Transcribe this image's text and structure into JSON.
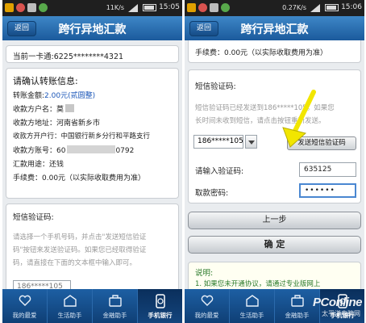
{
  "left": {
    "status": {
      "speed": "11K/s",
      "time": "15:05"
    },
    "header": {
      "back_label": "返回",
      "title": "跨行异地汇款"
    },
    "account_line": "当前一卡通:6225********4321",
    "confirm": {
      "heading": "请确认转账信息:",
      "amount_label": "转账金额:",
      "amount_value": "2.00元(贰圆整)",
      "payee_name": "收款方户名：莫",
      "payee_address": "收款方地址：河南省新乡市",
      "payee_bank": "收款方开户行：中国银行新乡分行和平路支行",
      "payee_account_prefix": "收款方账号：60",
      "payee_account_suffix": "0792",
      "purpose": "汇款用途：还钱",
      "fee": "手续费：0.00元（以实际收取费用为准）"
    },
    "sms": {
      "heading": "短信验证码:",
      "instr1": "请选择一个手机号码，并点击\"发送短信验证",
      "instr2": "码\"按钮来发送验证码。如果您已经取得验证",
      "instr3": "码，请直接在下面的文本框中输入即可。",
      "phone_partial": "186*****105"
    },
    "tabs": [
      {
        "label": "我的最爱",
        "icon": "heart-icon"
      },
      {
        "label": "生活助手",
        "icon": "life-helper-icon"
      },
      {
        "label": "金融助手",
        "icon": "finance-helper-icon"
      },
      {
        "label": "手机银行",
        "icon": "mobile-bank-icon"
      }
    ]
  },
  "right": {
    "status": {
      "speed": "0.27K/s",
      "time": "15:06"
    },
    "header": {
      "back_label": "返回",
      "title": "跨行异地汇款"
    },
    "fee": "手续费：0.00元（以实际收取费用为准）",
    "sms": {
      "heading": "短信验证码:",
      "sent1": "短信验证码已经发送到186*****105。如果您",
      "sent2": "长时间未收到短信，请点击按钮重新发送。",
      "phone_value": "186*****105",
      "send_button": "发送短信验证码",
      "code_label": "请输入验证码:",
      "code_value": "635125",
      "password_label": "取款密码:",
      "password_value": "••••••"
    },
    "prev_button": "上一步",
    "confirm_button": "确  定",
    "note_heading": "说明:",
    "note_line1": "1. 如果您未开通协议，请通过专业版网上",
    "tabs": [
      {
        "label": "我的最爱",
        "icon": "heart-icon"
      },
      {
        "label": "生活助手",
        "icon": "life-helper-icon"
      },
      {
        "label": "金融助手",
        "icon": "finance-helper-icon"
      },
      {
        "label": "手机银行",
        "icon": "mobile-bank-icon"
      }
    ],
    "watermark_brand": "PConline",
    "watermark_sub": "太平洋电脑网"
  },
  "colors": {
    "header_blue": "#1b5a9c",
    "accent_arrow": "#f2e600",
    "amount_blue": "#1a56b8"
  }
}
